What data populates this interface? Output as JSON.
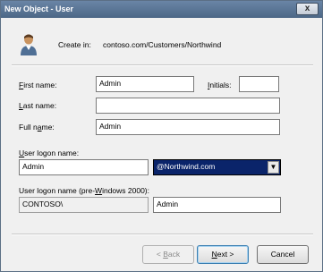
{
  "window": {
    "title": "New Object - User",
    "close_glyph": "x"
  },
  "header": {
    "icon": "user-icon",
    "create_in_label": "Create in:",
    "create_in_value": "contoso.com/Customers/Northwind"
  },
  "form": {
    "first_name": {
      "label_key": "F",
      "label_rest": "irst name:",
      "value": "Admin"
    },
    "initials": {
      "label_key": "I",
      "label_rest": "nitials:",
      "value": ""
    },
    "last_name": {
      "label_key": "L",
      "label_rest": "ast name:",
      "value": ""
    },
    "full_name": {
      "label_pre": "Full n",
      "label_key": "a",
      "label_rest": "me:",
      "value": "Admin"
    },
    "logon_name": {
      "label_key": "U",
      "label_rest": "ser logon name:",
      "value": "Admin"
    },
    "upn_suffix": {
      "value": "@Northwind.com",
      "arrow": "▼"
    },
    "logon_name_pre2000": {
      "label_pre": "User logon name (pre-",
      "label_key": "W",
      "label_rest": "indows 2000):",
      "domain_value": "CONTOSO\\",
      "value": "Admin"
    }
  },
  "buttons": {
    "back": {
      "pre": "< ",
      "key": "B",
      "rest": "ack"
    },
    "next": {
      "key": "N",
      "rest": "ext >"
    },
    "cancel": "Cancel"
  }
}
